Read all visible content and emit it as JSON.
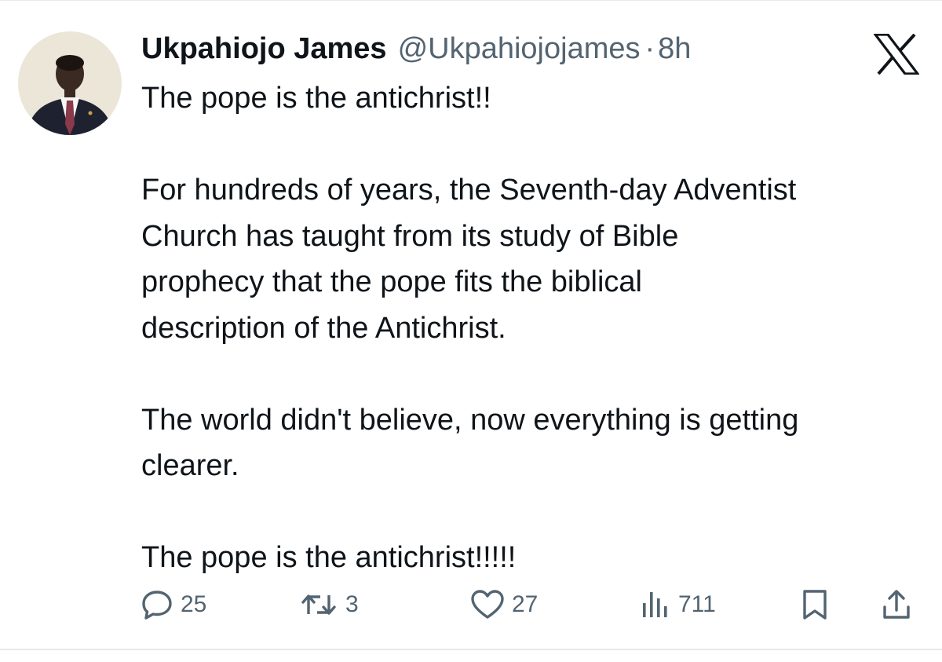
{
  "author": {
    "name": "Ukpahiojo James",
    "handle": "@Ukpahiojojames",
    "separator": "·",
    "time": "8h"
  },
  "tweet": {
    "paragraphs": [
      "The pope is the antichrist!!",
      "For hundreds of years, the Seventh-day Adventist\nChurch has taught from its study of Bible\nprophecy that the pope fits the biblical\ndescription of the Antichrist.",
      "The world didn't believe, now everything is getting\nclearer.",
      "The pope is the antichrist!!!!!"
    ]
  },
  "actions": {
    "replies": "25",
    "reposts": "3",
    "likes": "27",
    "views": "711"
  },
  "icons": {
    "logo": "x-logo-icon",
    "reply": "reply-icon",
    "repost": "repost-icon",
    "like": "heart-icon",
    "views": "views-chart-icon",
    "bookmark": "bookmark-icon",
    "share": "share-icon"
  },
  "colors": {
    "text": "#0f1419",
    "secondary": "#536471",
    "divider": "#e7e9ea"
  }
}
